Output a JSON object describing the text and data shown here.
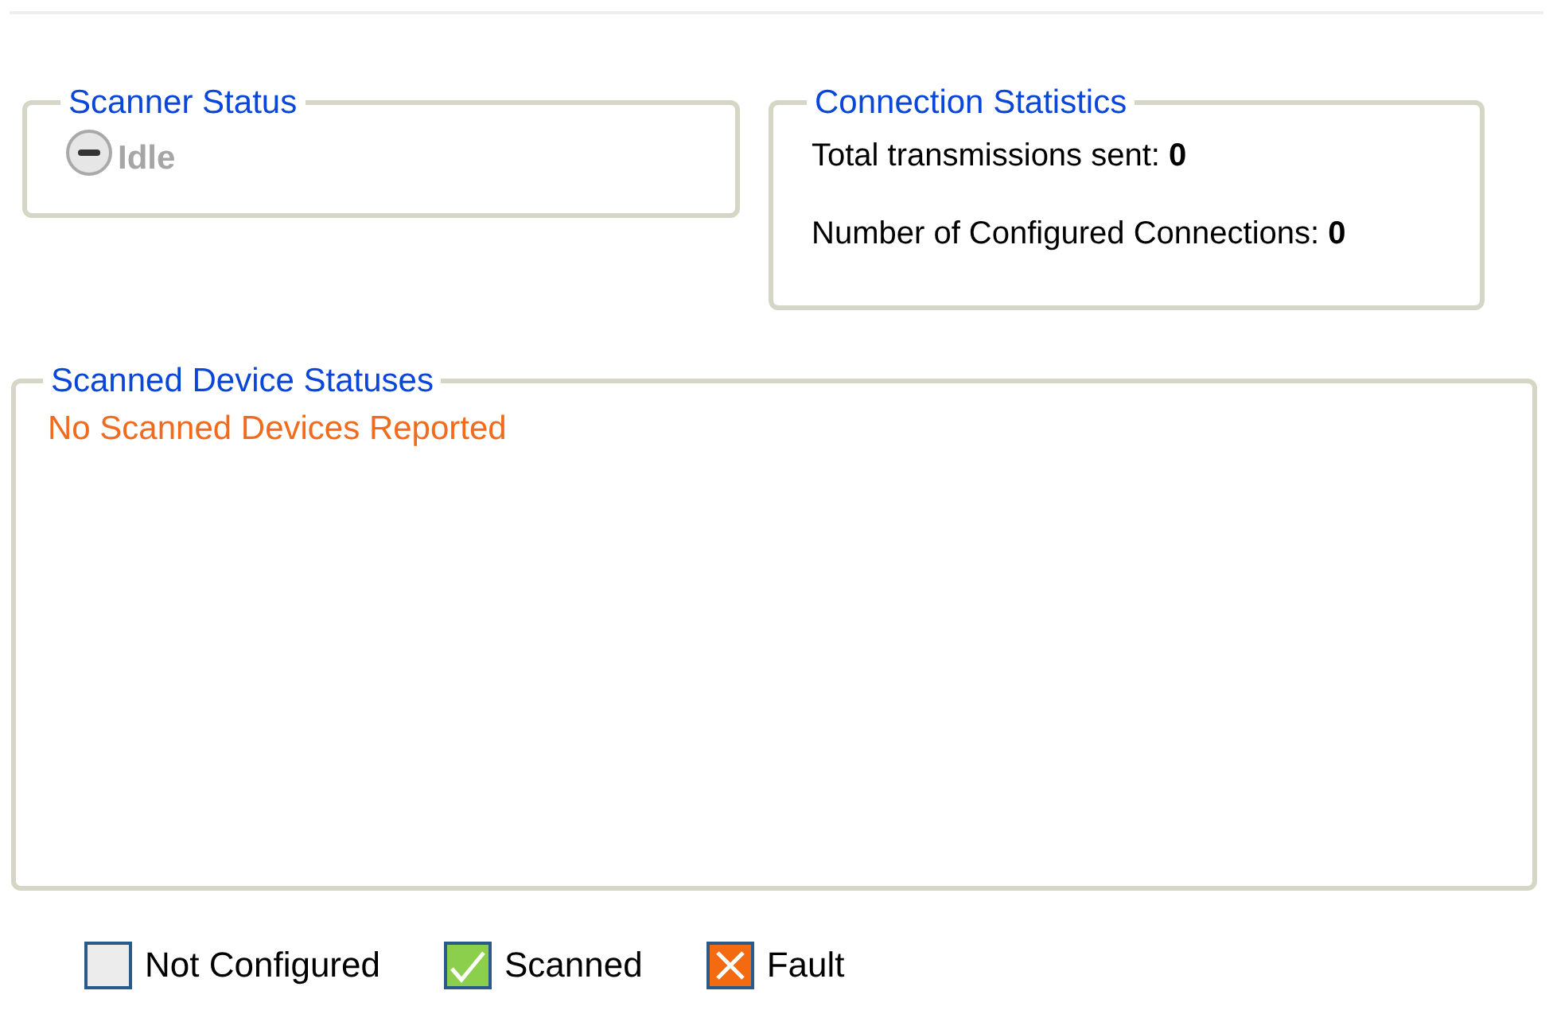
{
  "scanner_status": {
    "title": "Scanner Status",
    "label": "Idle"
  },
  "connection_statistics": {
    "title": "Connection Statistics",
    "items": [
      {
        "label": "Total transmissions sent: ",
        "value": "0"
      },
      {
        "label": "Number of Configured Connections: ",
        "value": "0"
      }
    ]
  },
  "scanned_device_statuses": {
    "title": "Scanned Device Statuses",
    "message": "No Scanned Devices Reported"
  },
  "legend": [
    {
      "kind": "not_configured",
      "label": "Not Configured"
    },
    {
      "kind": "scanned",
      "label": "Scanned"
    },
    {
      "kind": "fault",
      "label": "Fault"
    }
  ]
}
